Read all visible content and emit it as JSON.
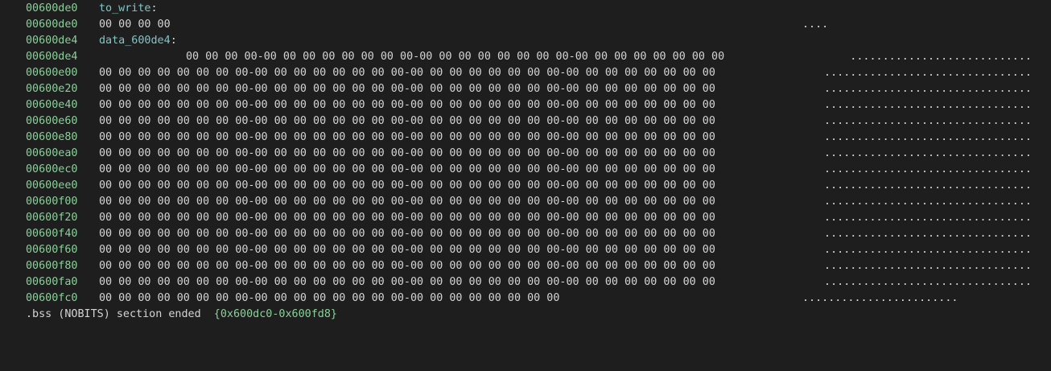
{
  "header_lines": [
    {
      "addr": "00600de0",
      "label": "to_write"
    },
    {
      "addr": "00600de0",
      "hex": "00 00 00 00",
      "ascii": "...."
    },
    {
      "addr": "00600de4",
      "label": "data_600de4"
    },
    {
      "addr": "00600de4",
      "hex": "00 00 00 00-00 00 00 00 00 00 00 00-00 00 00 00 00 00 00 00-00 00 00 00 00 00 00 00",
      "ascii": "............................"
    }
  ],
  "rows": [
    {
      "addr": "00600e00",
      "hex": "00 00 00 00 00 00 00 00-00 00 00 00 00 00 00 00-00 00 00 00 00 00 00 00-00 00 00 00 00 00 00 00",
      "ascii": "................................"
    },
    {
      "addr": "00600e20",
      "hex": "00 00 00 00 00 00 00 00-00 00 00 00 00 00 00 00-00 00 00 00 00 00 00 00-00 00 00 00 00 00 00 00",
      "ascii": "................................"
    },
    {
      "addr": "00600e40",
      "hex": "00 00 00 00 00 00 00 00-00 00 00 00 00 00 00 00-00 00 00 00 00 00 00 00-00 00 00 00 00 00 00 00",
      "ascii": "................................"
    },
    {
      "addr": "00600e60",
      "hex": "00 00 00 00 00 00 00 00-00 00 00 00 00 00 00 00-00 00 00 00 00 00 00 00-00 00 00 00 00 00 00 00",
      "ascii": "................................"
    },
    {
      "addr": "00600e80",
      "hex": "00 00 00 00 00 00 00 00-00 00 00 00 00 00 00 00-00 00 00 00 00 00 00 00-00 00 00 00 00 00 00 00",
      "ascii": "................................"
    },
    {
      "addr": "00600ea0",
      "hex": "00 00 00 00 00 00 00 00-00 00 00 00 00 00 00 00-00 00 00 00 00 00 00 00-00 00 00 00 00 00 00 00",
      "ascii": "................................"
    },
    {
      "addr": "00600ec0",
      "hex": "00 00 00 00 00 00 00 00-00 00 00 00 00 00 00 00-00 00 00 00 00 00 00 00-00 00 00 00 00 00 00 00",
      "ascii": "................................"
    },
    {
      "addr": "00600ee0",
      "hex": "00 00 00 00 00 00 00 00-00 00 00 00 00 00 00 00-00 00 00 00 00 00 00 00-00 00 00 00 00 00 00 00",
      "ascii": "................................"
    },
    {
      "addr": "00600f00",
      "hex": "00 00 00 00 00 00 00 00-00 00 00 00 00 00 00 00-00 00 00 00 00 00 00 00-00 00 00 00 00 00 00 00",
      "ascii": "................................"
    },
    {
      "addr": "00600f20",
      "hex": "00 00 00 00 00 00 00 00-00 00 00 00 00 00 00 00-00 00 00 00 00 00 00 00-00 00 00 00 00 00 00 00",
      "ascii": "................................"
    },
    {
      "addr": "00600f40",
      "hex": "00 00 00 00 00 00 00 00-00 00 00 00 00 00 00 00-00 00 00 00 00 00 00 00-00 00 00 00 00 00 00 00",
      "ascii": "................................"
    },
    {
      "addr": "00600f60",
      "hex": "00 00 00 00 00 00 00 00-00 00 00 00 00 00 00 00-00 00 00 00 00 00 00 00-00 00 00 00 00 00 00 00",
      "ascii": "................................"
    },
    {
      "addr": "00600f80",
      "hex": "00 00 00 00 00 00 00 00-00 00 00 00 00 00 00 00-00 00 00 00 00 00 00 00-00 00 00 00 00 00 00 00",
      "ascii": "................................"
    },
    {
      "addr": "00600fa0",
      "hex": "00 00 00 00 00 00 00 00-00 00 00 00 00 00 00 00-00 00 00 00 00 00 00 00-00 00 00 00 00 00 00 00",
      "ascii": "................................"
    },
    {
      "addr": "00600fc0",
      "hex": "00 00 00 00 00 00 00 00-00 00 00 00 00 00 00 00-00 00 00 00 00 00 00 00",
      "ascii": "........................"
    }
  ],
  "footer": {
    "text": ".bss (NOBITS) section ended  ",
    "range": "{0x600dc0-0x600fd8}"
  },
  "colors": {
    "background": "#1e1e1e",
    "text": "#d4d4d4",
    "address": "#8ccf9a",
    "label": "#7fc6c6"
  }
}
